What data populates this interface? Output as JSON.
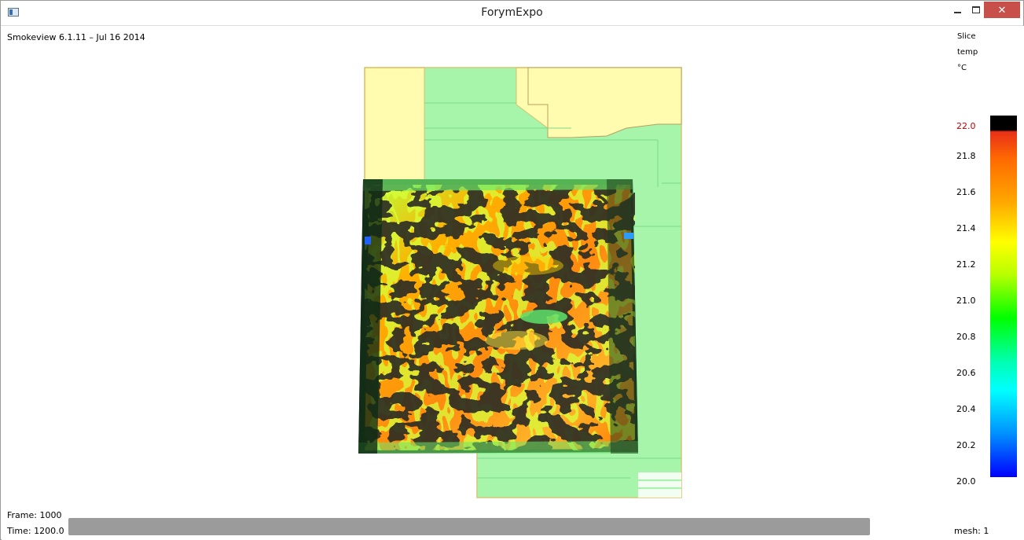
{
  "window": {
    "title": "ForymExpo",
    "close_glyph": "✕"
  },
  "hud": {
    "version": "Smokeview 6.1.11 – Jul 16 2014",
    "frame": "Frame: 1000",
    "time": "Time: 1200.0",
    "mesh": "mesh: 1"
  },
  "colorbar": {
    "slice": "Slice",
    "quantity": "temp",
    "unit": "°C",
    "ticks": [
      "22.0",
      "21.8",
      "21.6",
      "21.4",
      "21.2",
      "21.0",
      "20.8",
      "20.6",
      "20.4",
      "20.2",
      "20.0"
    ]
  },
  "icons": {
    "app": "app-window-icon",
    "minimize": "minimize-icon",
    "maximize": "maximize-icon",
    "close": "close-icon"
  },
  "colors": {
    "close_btn": "#c7504a",
    "floor_yellow": "#fffcb0",
    "floor_green": "#a6f5aa",
    "hot_dark": "#2a2a22"
  }
}
